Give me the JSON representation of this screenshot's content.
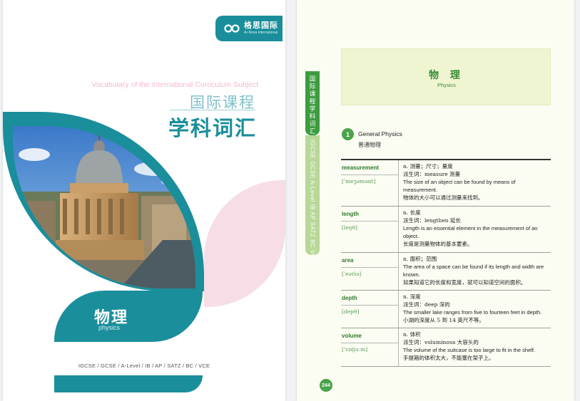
{
  "cover": {
    "logo": {
      "cn": "格思国际",
      "en": "Ar-Nova International"
    },
    "subtitle_en": "Vocabulary of the International Curriculum Subject",
    "title_line1": "国际课程",
    "title_line2": "学科词汇",
    "subject_cn": "物理",
    "subject_en": "physics",
    "curricula": "IGCSE / GCSE / A-Level / IB / AP / SATZ / BC / VCE",
    "colors": {
      "teal": "#1a8e9b",
      "pink": "#f6dde6"
    },
    "image": "radcliffe-camera-oxford-photo"
  },
  "page": {
    "side_tab": "国际课程学科词汇",
    "side_strip": "IGCSE GCSE A-Level IB AP SATZ BC VCE",
    "heading_cn": "物 理",
    "heading_en": "Physics",
    "section": {
      "number": "1",
      "en": "General Physics",
      "cn": "普通物理"
    },
    "entries": [
      {
        "term": "measurement",
        "ipa": "[ˈmeʒəmənt]",
        "pos": "n. 测量；尺寸；量度",
        "derived": "派生词：measure 测量",
        "example_en": "The size of an object can be found by means of measurement.",
        "example_cn": "物体的大小可以通过测量来找到。"
      },
      {
        "term": "length",
        "ipa": "[leŋθ]",
        "pos": "n. 长度",
        "derived": "派生词：lengthen 延长",
        "example_en": "Length is an essential element in the measurement of an object.",
        "example_cn": "长度是测量物体的基本要素。"
      },
      {
        "term": "area",
        "ipa": "[ˈeəriə]",
        "pos": "n. 面积；范围",
        "derived": "",
        "example_en": "The area of a space can be found if its length and width are known.",
        "example_cn": "如果知道它的长度和宽度，就可以知道空间的面积。"
      },
      {
        "term": "depth",
        "ipa": "[depθ]",
        "pos": "n. 深度",
        "derived": "派生词：deep 深的",
        "example_en": "The smaller lake ranges from five to fourteen feet in depth.",
        "example_cn": "小湖的深度从 5 到 14 英尺不等。"
      },
      {
        "term": "volume",
        "ipa": "[ˈvɒljuːm]",
        "pos": "n. 体积",
        "derived": "派生词：voluminous 大容头的",
        "example_en": "The volume of the suitcase is too large to fit in the shelf.",
        "example_cn": "手提箱的体积太大，不能塞在架子上。"
      }
    ],
    "page_number": "244",
    "colors": {
      "green": "#3c9c3f",
      "light_green": "#b7d896",
      "header_bg": "#eff5d0"
    }
  }
}
